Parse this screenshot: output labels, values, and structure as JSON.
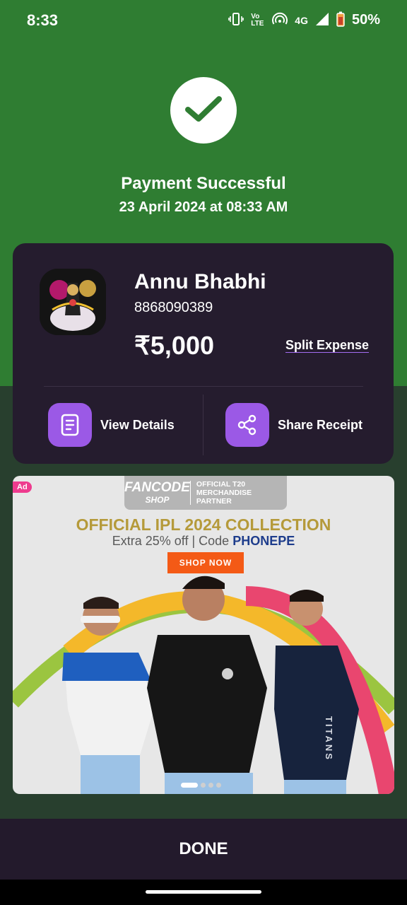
{
  "status_bar": {
    "time": "8:33",
    "volte": "Vo LTE",
    "network": "4G",
    "battery": "50%",
    "icons": [
      "vibrate-icon",
      "volte-icon",
      "hotspot-icon",
      "signal-icon",
      "battery-icon"
    ]
  },
  "header": {
    "title": "Payment Successful",
    "datetime": "23 April 2024 at 08:33 AM",
    "icon": "check-icon"
  },
  "payee": {
    "name": "Annu Bhabhi",
    "phone": "8868090389",
    "amount": "₹5,000",
    "split_label": "Split Expense"
  },
  "actions": [
    {
      "label": "View Details",
      "icon": "document-icon"
    },
    {
      "label": "Share Receipt",
      "icon": "share-icon"
    }
  ],
  "ad": {
    "badge": "Ad",
    "brand": "FANCODE",
    "brand_sub": "SHOP",
    "partner_text": "OFFICIAL T20 MERCHANDISE PARTNER",
    "headline": "OFFICIAL IPL 2024 COLLECTION",
    "offer": "Extra 25% off | Code",
    "code": "PHONEPE",
    "cta": "SHOP NOW",
    "jersey_text": "TITANS"
  },
  "done_label": "DONE",
  "colors": {
    "success_green": "#2f7d32",
    "dark_green": "#283f2e",
    "card_bg": "#251c2e",
    "accent_purple": "#9b59e6",
    "cta_orange": "#f45a16"
  }
}
